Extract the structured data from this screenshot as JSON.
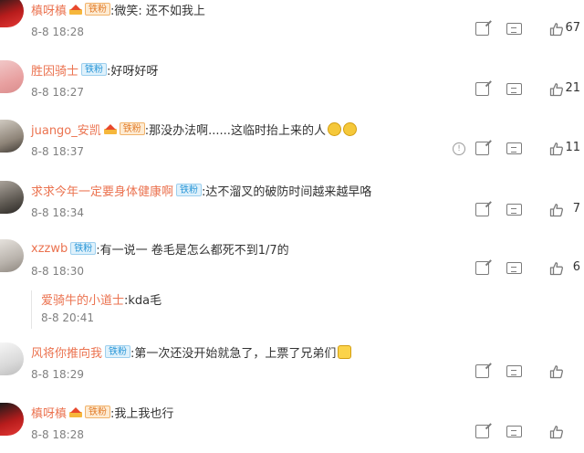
{
  "comments": [
    {
      "username": "槙呀槙",
      "name_color": "orange",
      "crown": true,
      "badge": "铁粉",
      "badge_color": "orange",
      "text": ":微笑: 还不如我上",
      "emojis": [],
      "time": "8-8 18:28",
      "report": false,
      "likes": "67",
      "avatar": "red"
    },
    {
      "username": "胜因骑士",
      "name_color": "orange",
      "crown": false,
      "badge": "铁粉",
      "badge_color": "blue",
      "text": ":好呀好呀",
      "emojis": [],
      "time": "8-8 18:27",
      "report": false,
      "likes": "21",
      "avatar": "pink"
    },
    {
      "username": "juango_安凯",
      "name_color": "orange",
      "crown": true,
      "badge": "铁粉",
      "badge_color": "orange",
      "text": ":那没办法啊......这临时抬上来的人",
      "emojis": [
        "face",
        "face"
      ],
      "time": "8-8 18:37",
      "report": true,
      "likes": "11",
      "avatar": "gray"
    },
    {
      "username": "求求今年一定要身体健康啊",
      "name_color": "orange",
      "crown": false,
      "badge": "铁粉",
      "badge_color": "blue",
      "text": ":达不溜叉的破防时间越来越早咯",
      "emojis": [],
      "time": "8-8 18:34",
      "report": false,
      "likes": "7",
      "avatar": "dark"
    },
    {
      "username": "xzzwb",
      "name_color": "orange",
      "crown": false,
      "badge": "铁粉",
      "badge_color": "blue",
      "text": ":有一说一 卷毛是怎么都死不到1/7的",
      "emojis": [],
      "time": "8-8 18:30",
      "report": false,
      "likes": "6",
      "avatar": "gray2",
      "reply": {
        "username": "爱骑牛的小道士",
        "text": ":kda毛",
        "time": "8-8 20:41"
      }
    },
    {
      "username": "风将你推向我",
      "name_color": "orange",
      "crown": false,
      "badge": "铁粉",
      "badge_color": "blue",
      "text": ":第一次还没开始就急了，上票了兄弟们",
      "emojis": [
        "flag"
      ],
      "time": "8-8 18:29",
      "report": false,
      "likes": "",
      "avatar": "light"
    },
    {
      "username": "槙呀槙",
      "name_color": "orange",
      "crown": true,
      "badge": "铁粉",
      "badge_color": "orange",
      "text": ":我上我也行",
      "emojis": [],
      "time": "8-8 18:28",
      "report": false,
      "likes": "",
      "avatar": "red"
    }
  ],
  "colors": {
    "username": "#eb7350",
    "time": "#808080",
    "text": "#333333"
  },
  "icons": {
    "share": "share-icon",
    "comment": "comment-icon",
    "like": "like-icon",
    "report": "report-icon"
  }
}
